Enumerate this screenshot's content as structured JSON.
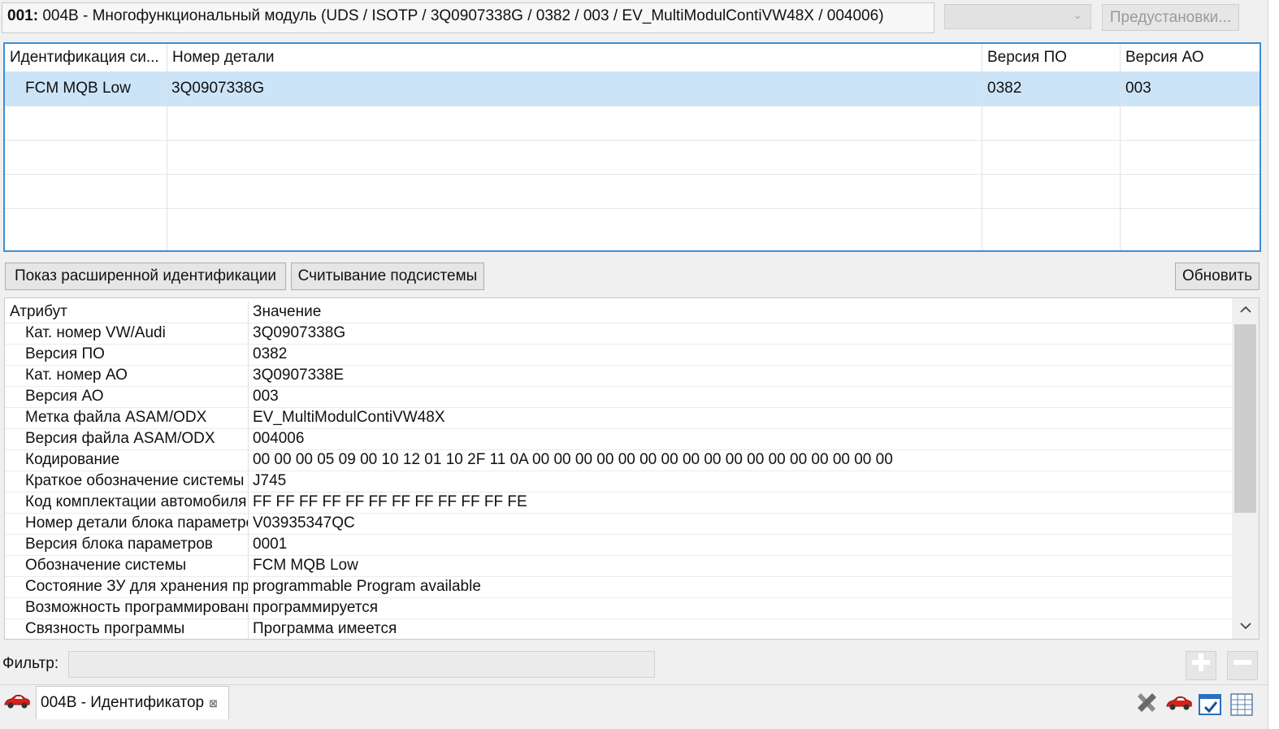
{
  "header": {
    "address_bold": "001:",
    "title": "004B - Многофункциональный модуль  (UDS / ISOTP / 3Q0907338G / 0382 / 003 / EV_MultiModulContiVW48X / 004006)",
    "presets_label": "Предустановки...",
    "dropdown_value": ""
  },
  "subsystem_table": {
    "columns": [
      "Идентификация си...",
      "Номер детали",
      "Версия ПО",
      "Версия АО"
    ],
    "rows": [
      [
        "FCM MQB Low",
        "3Q0907338G",
        "0382",
        "003"
      ]
    ]
  },
  "buttons": {
    "extended_id": "Показ расширенной идентификации",
    "read_subsystem": "Считывание подсистемы",
    "refresh": "Обновить"
  },
  "attribute_table": {
    "columns": [
      "Атрибут",
      "Значение"
    ],
    "rows": [
      [
        "Кат. номер VW/Audi",
        "3Q0907338G"
      ],
      [
        "Версия ПО",
        "0382"
      ],
      [
        "Кат. номер АО",
        "3Q0907338E"
      ],
      [
        "Версия АО",
        "003"
      ],
      [
        "Метка файла ASAM/ODX",
        "EV_MultiModulContiVW48X"
      ],
      [
        "Версия файла ASAM/ODX",
        "004006"
      ],
      [
        "Кодирование",
        "00 00 00 05 09 00 10 12 01 10 2F 11 0A 00 00 00 00 00 00 00 00 00 00 00 00 00 00 00 00 00"
      ],
      [
        "Краткое обозначение системы",
        "J745"
      ],
      [
        "Код комплектации автомобиля",
        "FF FF FF FF FF FF FF FF FF FF FF FE"
      ],
      [
        "Номер детали блока параметров",
        "V03935347QC"
      ],
      [
        "Версия блока параметров",
        "0001"
      ],
      [
        "Обозначение системы",
        "FCM MQB Low"
      ],
      [
        "Состояние ЗУ для хранения программ",
        "programmable Program available"
      ],
      [
        "Возможность программирования",
        "программируется"
      ],
      [
        "Связность программы",
        "Программа имеется"
      ]
    ]
  },
  "filter": {
    "label": "Фильтр:",
    "value": ""
  },
  "bottom_tab": {
    "label": "004B - Идентификатор"
  },
  "icons": {
    "car": "car-icon",
    "close": "close-icon",
    "tools": "tools-icon",
    "window": "window-check-icon",
    "grid": "grid-icon"
  }
}
